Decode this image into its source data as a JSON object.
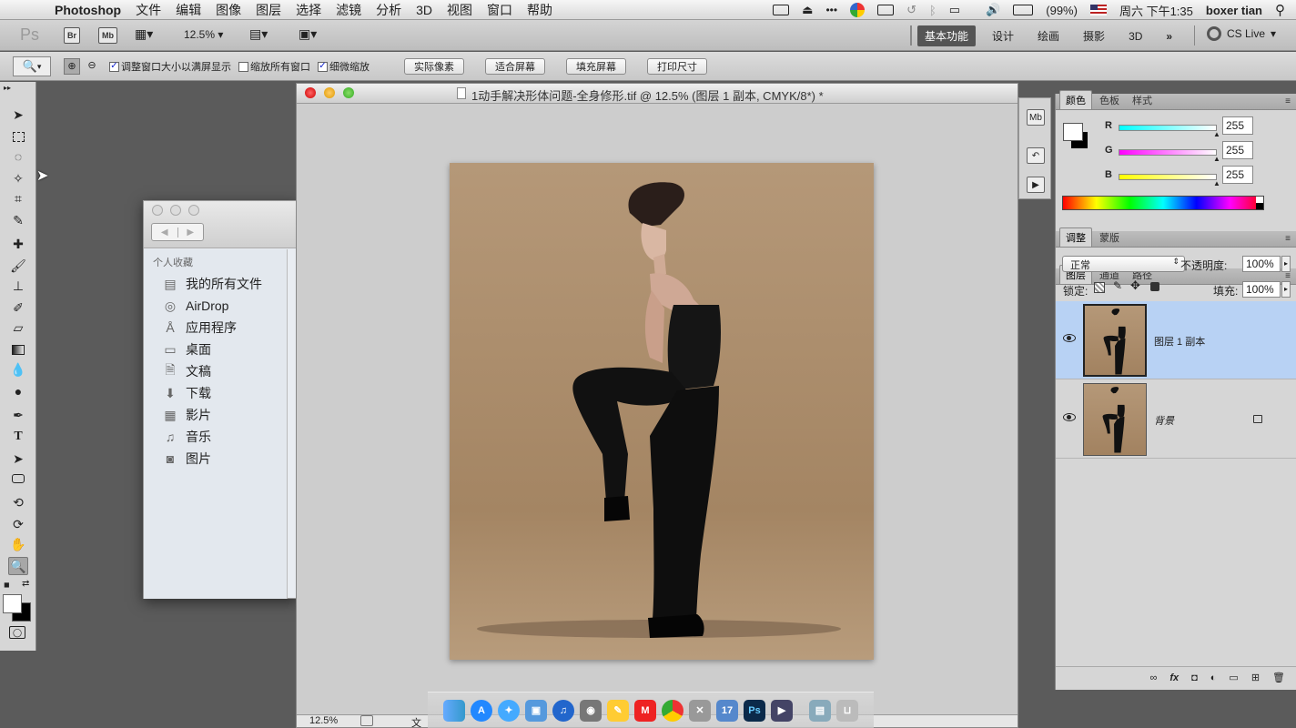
{
  "menubar": {
    "app_name": "Photoshop",
    "menus": [
      "文件",
      "编辑",
      "图像",
      "图层",
      "选择",
      "滤镜",
      "分析",
      "3D",
      "视图",
      "窗口",
      "帮助"
    ],
    "battery": "(99%)",
    "clock": "周六 下午1:35",
    "user": "boxer tian"
  },
  "appbar": {
    "ps_logo": "Ps",
    "br": "Br",
    "mb": "Mb",
    "zoom": "12.5%",
    "workspaces": [
      "基本功能",
      "设计",
      "绘画",
      "摄影",
      "3D"
    ],
    "more": "»",
    "cs_live": "CS Live"
  },
  "options": {
    "check_resize": "调整窗口大小以满屏显示",
    "check_zoom_all": "缩放所有窗口",
    "check_scrubby": "细微缩放",
    "btn_actual": "实际像素",
    "btn_fit": "适合屏幕",
    "btn_fill": "填充屏幕",
    "btn_print": "打印尺寸"
  },
  "finder": {
    "section": "个人收藏",
    "items": [
      {
        "icon": "all-files-icon",
        "label": "我的所有文件"
      },
      {
        "icon": "airdrop-icon",
        "label": "AirDrop"
      },
      {
        "icon": "applications-icon",
        "label": "应用程序"
      },
      {
        "icon": "desktop-icon",
        "label": "桌面"
      },
      {
        "icon": "documents-icon",
        "label": "文稿"
      },
      {
        "icon": "downloads-icon",
        "label": "下载"
      },
      {
        "icon": "movies-icon",
        "label": "影片"
      },
      {
        "icon": "music-icon",
        "label": "音乐"
      },
      {
        "icon": "pictures-icon",
        "label": "图片"
      }
    ]
  },
  "document": {
    "title": "1动手解决形体问题-全身修形.tif @ 12.5% (图层 1 副本, CMYK/8*) *",
    "status_zoom": "12.5%",
    "status_text": "文"
  },
  "color_panel": {
    "tabs": [
      "颜色",
      "色板",
      "样式"
    ],
    "channels": [
      {
        "label": "R",
        "value": "255"
      },
      {
        "label": "G",
        "value": "255"
      },
      {
        "label": "B",
        "value": "255"
      }
    ],
    "colors": {
      "foreground": "#ffffff",
      "background": "#000000"
    }
  },
  "adjust_panel": {
    "tabs": [
      "调整",
      "蒙版"
    ]
  },
  "layers_panel": {
    "tabs": [
      "图层",
      "通道",
      "路径"
    ],
    "blend_mode": "正常",
    "opacity_label": "不透明度:",
    "opacity": "100%",
    "lock_label": "锁定:",
    "fill_label": "填充:",
    "fill": "100%",
    "layers": [
      {
        "name": "图层 1 副本",
        "selected": true
      },
      {
        "name": "背景",
        "selected": false,
        "locked": true
      }
    ]
  },
  "dock": {
    "apps": [
      "finder-icon",
      "app-store-icon",
      "safari-icon",
      "preview-icon",
      "itunes-icon",
      "photo-icon",
      "notes-icon",
      "mail-icon",
      "chrome-icon",
      "utility-icon",
      "ical-icon",
      "photoshop-icon",
      "video-icon",
      "folder-icon",
      "trash-icon"
    ],
    "ps_label": "Ps",
    "mail_label": "M"
  }
}
